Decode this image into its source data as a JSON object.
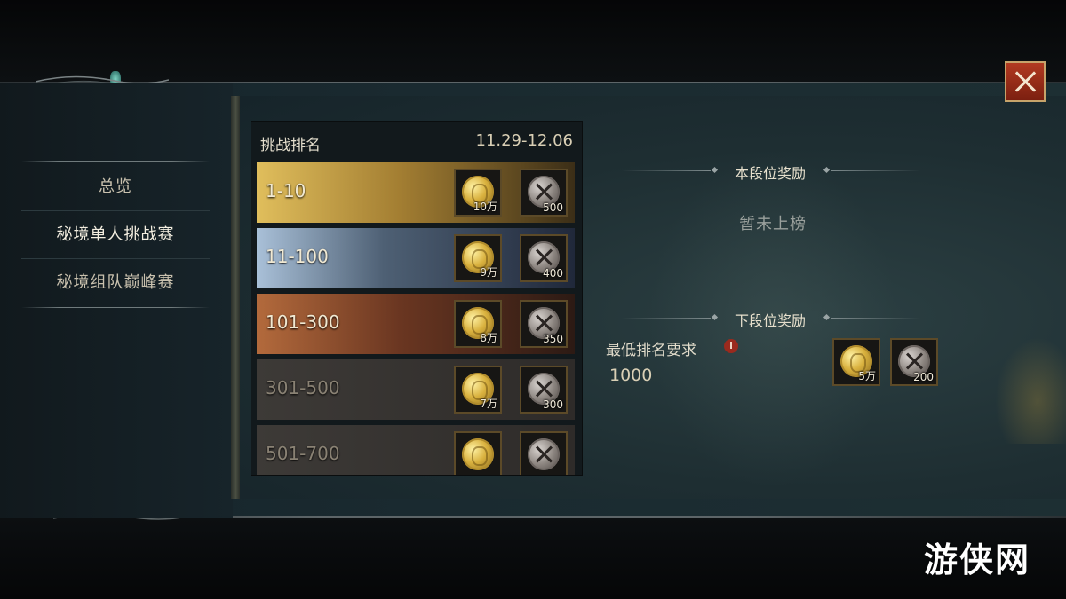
{
  "sidebar": {
    "items": [
      {
        "label": "总览"
      },
      {
        "label": "秘境单人挑战赛"
      },
      {
        "label": "秘境组队巅峰赛"
      }
    ]
  },
  "ranking": {
    "title": "挑战排名",
    "date_range": "11.29-12.06",
    "rows": [
      {
        "range": "1-10",
        "coin": "10万",
        "medal": "500"
      },
      {
        "range": "11-100",
        "coin": "9万",
        "medal": "400"
      },
      {
        "range": "101-300",
        "coin": "8万",
        "medal": "350"
      },
      {
        "range": "301-500",
        "coin": "7万",
        "medal": "300"
      },
      {
        "range": "501-700",
        "coin": "",
        "medal": ""
      }
    ]
  },
  "current_tier": {
    "title": "本段位奖励",
    "status": "暂未上榜"
  },
  "next_tier": {
    "title": "下段位奖励",
    "requirement_label": "最低排名要求",
    "requirement_value": "1000",
    "coin": "5万",
    "medal": "200"
  },
  "watermark": "游侠网",
  "icons": {
    "close": "close-icon",
    "info": "info-icon",
    "coin": "gold-coin-icon",
    "medal": "crossed-swords-medal-icon"
  }
}
